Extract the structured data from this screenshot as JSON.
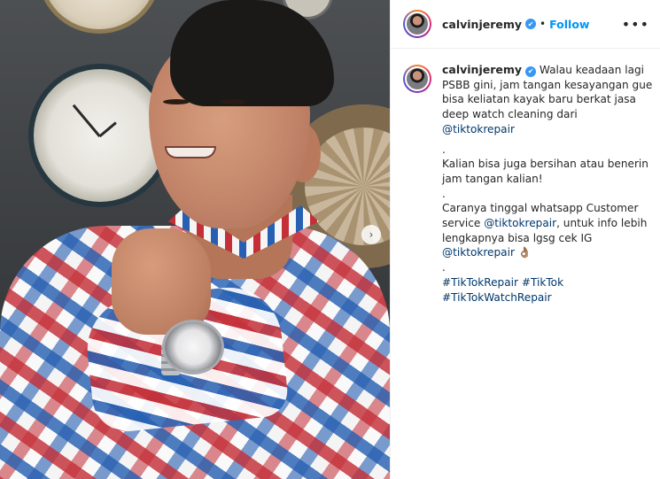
{
  "post": {
    "username": "calvinjeremy",
    "separator": "•",
    "follow_label": "Follow",
    "more_label": "•••",
    "verified_glyph": "✔",
    "carousel_next_glyph": "›"
  },
  "caption": {
    "username": "calvinjeremy",
    "lines": [
      "Walau keadaan lagi",
      "PSBB gini, jam tangan kesayangan gue",
      "bisa keliatan kayak baru berkat jasa",
      "deep watch cleaning dari",
      "@tiktokrepair",
      ".",
      "Kalian bisa juga bersihan atau benerin",
      "jam tangan kalian!",
      ".",
      "Caranya tinggal whatsapp Customer",
      "service",
      "@tiktokrepair",
      ", untuk info lebih",
      "lengkapnya bisa lgsg cek IG",
      "@tiktokrepair",
      "👌🏽",
      ".",
      "#TikTokRepair",
      "#TikTok",
      "#TikTokWatchRepair"
    ]
  },
  "colors": {
    "link": "#00376b",
    "follow": "#0095f6",
    "verified": "#3897f0"
  },
  "icons": [
    "verified-badge-icon",
    "more-options-icon",
    "carousel-next-icon",
    "avatar"
  ]
}
